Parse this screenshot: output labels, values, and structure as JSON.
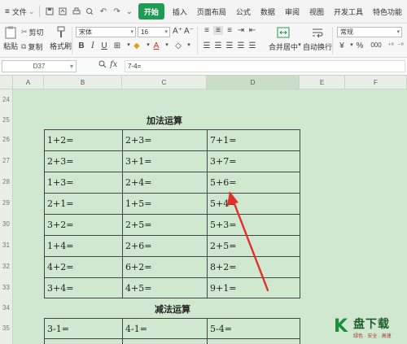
{
  "menubar": {
    "file_label": "文件",
    "tabs": [
      "开始",
      "插入",
      "页面布局",
      "公式",
      "数据",
      "审阅",
      "视图",
      "开发工具",
      "特色功能"
    ],
    "active_tab": "开始"
  },
  "ribbon": {
    "paste": "粘贴",
    "cut": "剪切",
    "copy": "复制",
    "format_painter": "格式刷",
    "font_name": "宋体",
    "font_size": "16",
    "merge_center": "合并居中",
    "auto_wrap": "自动换行",
    "number_format": "常规",
    "currency_symbol": "¥",
    "percent_symbol": "%",
    "thousands_symbol": "000"
  },
  "formula_bar": {
    "name_box": "D37",
    "fx_label": "fx",
    "content": "7-4="
  },
  "sheet": {
    "columns": [
      "A",
      "B",
      "C",
      "D",
      "E",
      "F"
    ],
    "selected_column": "D",
    "rows": [
      "24",
      "25",
      "26",
      "27",
      "28",
      "29",
      "30",
      "31",
      "32",
      "33",
      "34",
      "35"
    ],
    "addition_title": "加法运算",
    "subtraction_title": "减法运算",
    "addition_table": [
      [
        "1+2=",
        "2+3=",
        "7+1="
      ],
      [
        "2+3=",
        "3+1=",
        "3+7="
      ],
      [
        "1+3=",
        "2+4=",
        "5+6="
      ],
      [
        "2+1=",
        "1+5=",
        "5+4="
      ],
      [
        "3+2=",
        "2+5=",
        "5+3="
      ],
      [
        "1+4=",
        "2+6=",
        "2+5="
      ],
      [
        "4+2=",
        "6+2=",
        "8+2="
      ],
      [
        "3+4=",
        "4+5=",
        "9+1="
      ]
    ],
    "subtraction_table": [
      [
        "3-1=",
        "4-1=",
        "5-4="
      ]
    ]
  },
  "watermark": {
    "main": "盘下载",
    "sub": "绿色 · 安全 · 高速"
  }
}
